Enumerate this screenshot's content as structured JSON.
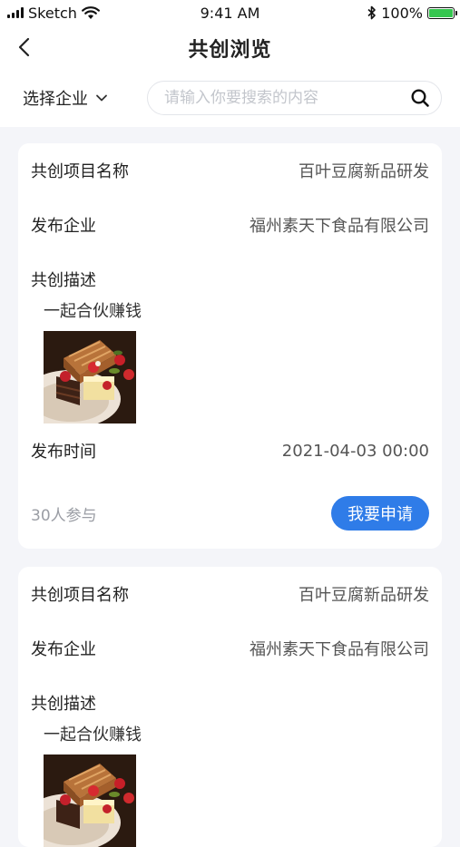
{
  "status_bar": {
    "carrier": "Sketch",
    "time": "9:41 AM",
    "battery_percent": "100%",
    "battery_level": 1.0,
    "icons": [
      "signal-icon",
      "wifi-icon",
      "bluetooth-icon",
      "battery-icon"
    ]
  },
  "header": {
    "title": "共创浏览",
    "back_icon": "back-icon"
  },
  "filter": {
    "company_select_label": "选择企业",
    "chevron_icon": "chevron-down-icon",
    "search_placeholder": "请输入你要搜索的内容",
    "search_value": "",
    "search_icon": "search-icon"
  },
  "cards": [
    {
      "project_name_label": "共创项目名称",
      "project_name": "百叶豆腐新品研发",
      "company_label": "发布企业",
      "company": "福州素天下食品有限公司",
      "description_label": "共创描述",
      "description": "一起合伙赚钱",
      "publish_time_label": "发布时间",
      "publish_time": "2021-04-03 00:00",
      "participants": "30人参与",
      "apply_label": "我要申请"
    },
    {
      "project_name_label": "共创项目名称",
      "project_name": "百叶豆腐新品研发",
      "company_label": "发布企业",
      "company": "福州素天下食品有限公司",
      "description_label": "共创描述",
      "description": "一起合伙赚钱"
    }
  ],
  "colors": {
    "accent": "#2f7ce8",
    "page_background": "#f4f5f9",
    "battery": "#35c64f"
  }
}
